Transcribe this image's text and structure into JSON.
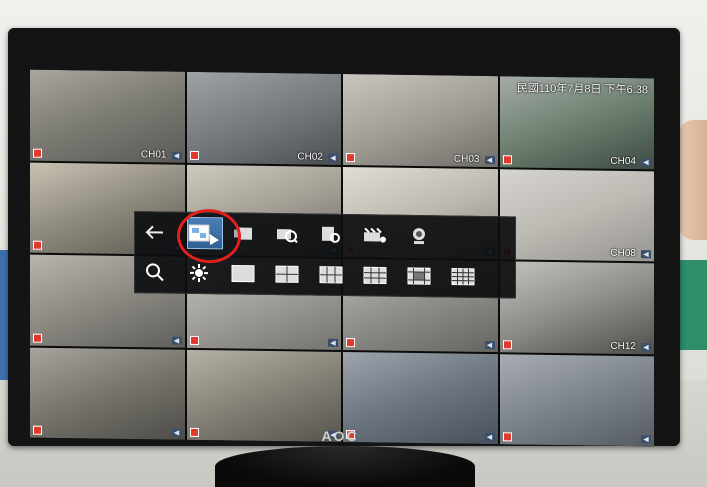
{
  "monitor": {
    "brand": "AOC"
  },
  "screen": {
    "datetime": "民國110年7月8日 下午6:38"
  },
  "tiles": [
    {
      "label": "CH01"
    },
    {
      "label": "CH02"
    },
    {
      "label": "CH03"
    },
    {
      "label": "CH04"
    },
    {
      "label": ""
    },
    {
      "label": ""
    },
    {
      "label": ""
    },
    {
      "label": ""
    },
    {
      "label": ""
    },
    {
      "label": ""
    },
    {
      "label": ""
    },
    {
      "label": "CH08"
    },
    {
      "label": ""
    },
    {
      "label": ""
    },
    {
      "label": ""
    },
    {
      "label": "CH12"
    }
  ],
  "menu": {
    "row1": [
      {
        "icon": "back-icon"
      },
      {
        "icon": "playback-icon"
      },
      {
        "icon": "search-record-icon"
      },
      {
        "icon": "event-search-icon"
      },
      {
        "icon": "backup-icon"
      },
      {
        "icon": "sequence-icon"
      },
      {
        "icon": "ptz-camera-icon"
      }
    ],
    "row2": [
      {
        "icon": "zoom-icon"
      },
      {
        "icon": "settings-icon"
      },
      {
        "icon": "layout-1-icon"
      },
      {
        "icon": "layout-4-icon"
      },
      {
        "icon": "layout-6-icon"
      },
      {
        "icon": "layout-9-icon"
      },
      {
        "icon": "layout-13-icon"
      },
      {
        "icon": "layout-16-icon"
      }
    ]
  },
  "colors": {
    "highlight": "#2f5f95",
    "annotation_circle": "#e01f1f",
    "record_badge": "#e03a2f"
  }
}
